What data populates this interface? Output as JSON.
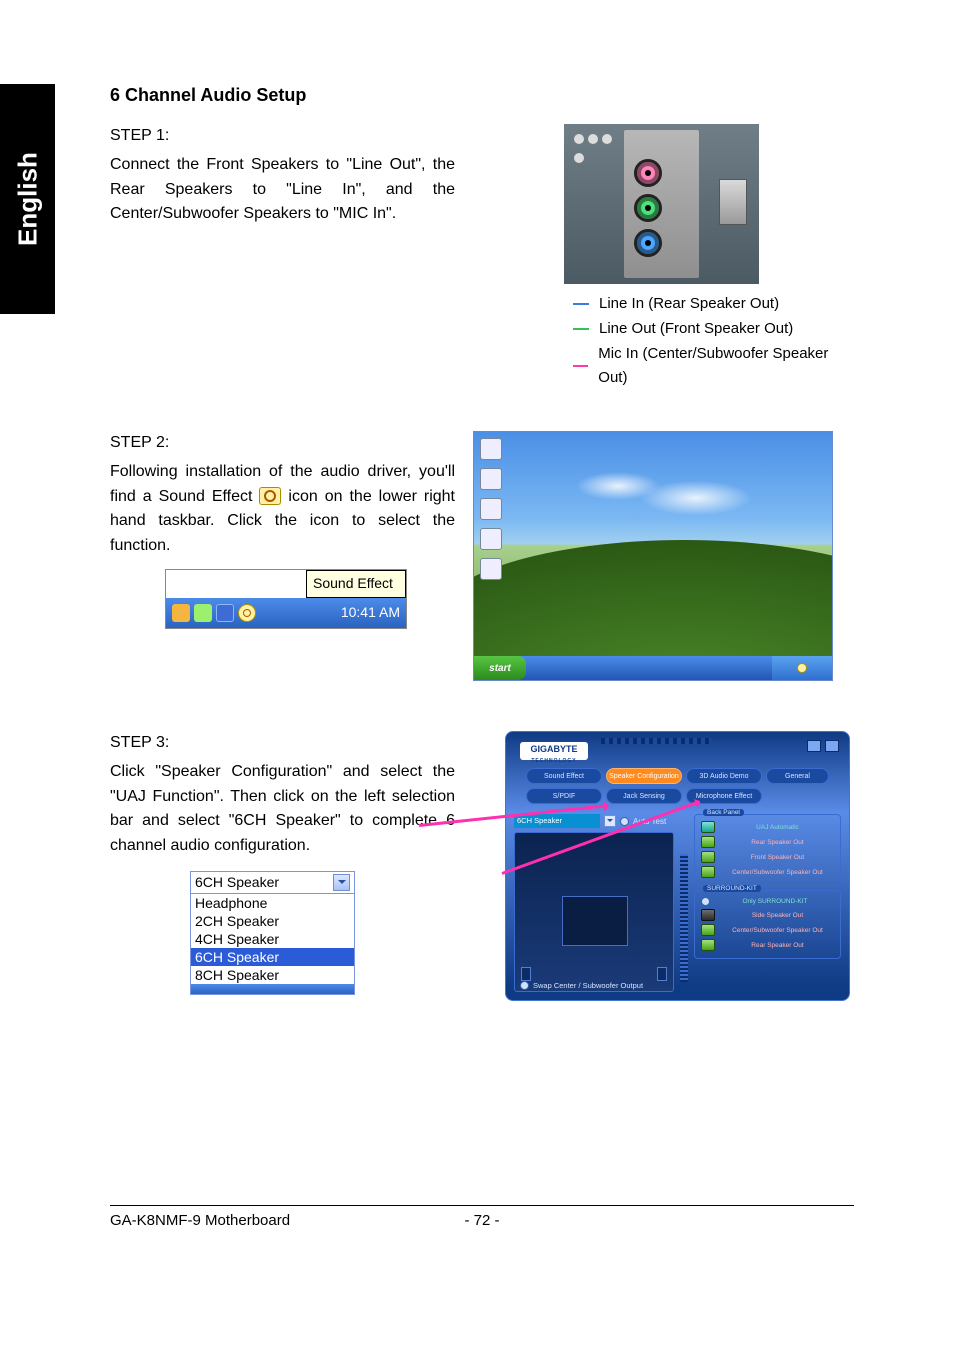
{
  "side_tab": "English",
  "section_title": "6 Channel Audio Setup",
  "step1": {
    "label": "STEP 1:",
    "text": "Connect the Front Speakers to \"Line Out\", the Rear Speakers to \"Line In\", and the Center/Subwoofer Speakers to \"MIC In\".",
    "callouts": {
      "line_in": "Line In (Rear Speaker Out)",
      "line_out": "Line Out (Front Speaker Out)",
      "mic_in": "Mic In (Center/Subwoofer Speaker Out)"
    }
  },
  "step2": {
    "label": "STEP 2:",
    "text_before_icon": "Following installation of the audio driver, you'll find a Sound Effect ",
    "text_after_icon": " icon on the lower right hand taskbar. Click the icon to select the function.",
    "tooltip": "Sound Effect",
    "tray_time": "10:41 AM",
    "xp_start": "start"
  },
  "step3": {
    "label": "STEP 3:",
    "text": "Click \"Speaker Configuration\" and select the \"UAJ Function\". Then click on the left selection bar and select \"6CH Speaker\" to complete 6 channel audio configuration.",
    "dropdown": {
      "selected": "6CH Speaker",
      "options": [
        "Headphone",
        "2CH Speaker",
        "4CH Speaker",
        "6CH Speaker",
        "8CH Speaker"
      ],
      "highlight": "6CH Speaker"
    },
    "panel": {
      "brand": "GIGABYTE",
      "brand_sub": "TECHNOLOGY",
      "tabs_row1": [
        "Sound Effect",
        "Speaker Configuration",
        "3D Audio Demo",
        "General"
      ],
      "tabs_row2": [
        "S/PDIF",
        "Jack Sensing",
        "Microphone Effect"
      ],
      "active_tab": "Speaker Configuration",
      "left_select": "6CH Speaker",
      "auto_test": "Auto Test",
      "back_panel": "Back Panel",
      "uaj_auto": "UAJ Automatic",
      "jacks_back": [
        "Rear Speaker Out",
        "Front Speaker Out",
        "Center/Subwoofer Speaker Out"
      ],
      "surround_kit": "SURROUND-KIT",
      "only_kit": "Only SURROUND-KIT",
      "jacks_kit": [
        "Side Speaker Out",
        "Center/Subwoofer Speaker Out",
        "Rear Speaker Out"
      ],
      "swap": "Swap Center / Subwoofer Output"
    }
  },
  "footer": {
    "left": "GA-K8NMF-9 Motherboard",
    "center": "- 72 -"
  }
}
